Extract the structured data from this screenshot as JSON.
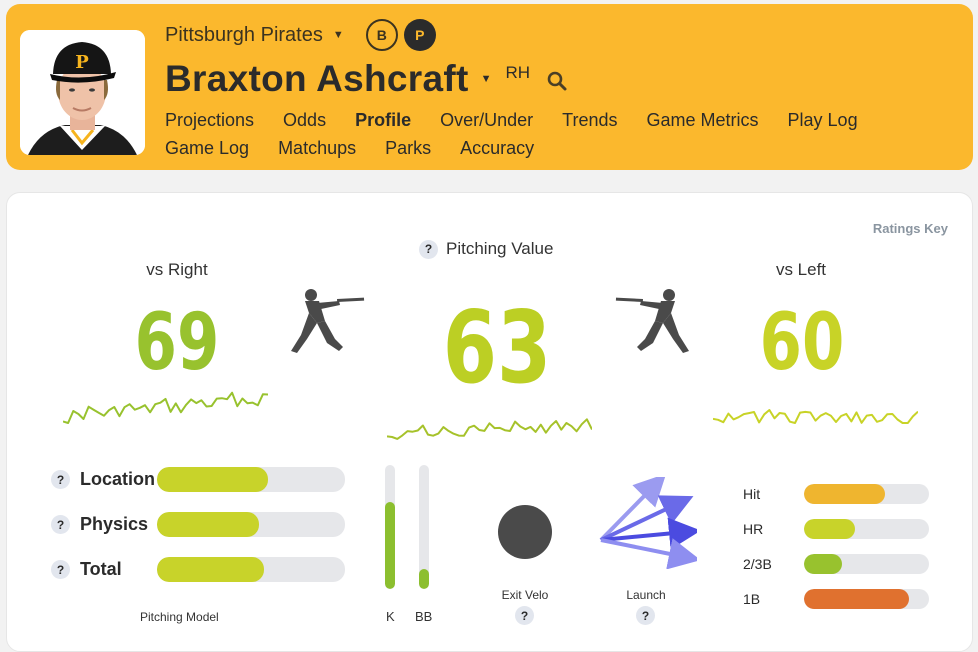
{
  "header": {
    "team": "Pittsburgh Pirates",
    "badge_b": "B",
    "badge_p": "P",
    "player": "Braxton Ashcraft",
    "hand": "RH",
    "nav": [
      "Projections",
      "Odds",
      "Profile",
      "Over/Under",
      "Trends",
      "Game Metrics",
      "Play Log",
      "Game Log",
      "Matchups",
      "Parks",
      "Accuracy"
    ],
    "active_nav": "Profile"
  },
  "ratings_key": "Ratings Key",
  "ratings": {
    "vs_right": {
      "label": "vs Right",
      "value": "69",
      "color": "#98c22e"
    },
    "pitching_value": {
      "label": "Pitching Value",
      "value": "63",
      "color": "#bccf24"
    },
    "vs_left": {
      "label": "vs Left",
      "value": "60",
      "color": "#c8d327"
    }
  },
  "pitching_model": {
    "label": "Pitching Model",
    "items": [
      {
        "label": "Location",
        "value": 0.59,
        "color": "#c8d32a"
      },
      {
        "label": "Physics",
        "value": 0.54,
        "color": "#c8d32a"
      },
      {
        "label": "Total",
        "value": 0.57,
        "color": "#c8d32a"
      }
    ]
  },
  "k_bb": {
    "k": {
      "label": "K",
      "value": 0.7
    },
    "bb": {
      "label": "BB",
      "value": 0.16
    }
  },
  "exit_velo": {
    "label": "Exit Velo",
    "color": "#4a4a4a"
  },
  "launch": {
    "label": "Launch"
  },
  "outcomes": [
    {
      "label": "Hit",
      "value": 0.65,
      "color": "#efb52f"
    },
    {
      "label": "HR",
      "value": 0.41,
      "color": "#c8d32a"
    },
    {
      "label": "2/3B",
      "value": 0.3,
      "color": "#98c22e"
    },
    {
      "label": "1B",
      "value": 0.84,
      "color": "#e0712f"
    }
  ]
}
